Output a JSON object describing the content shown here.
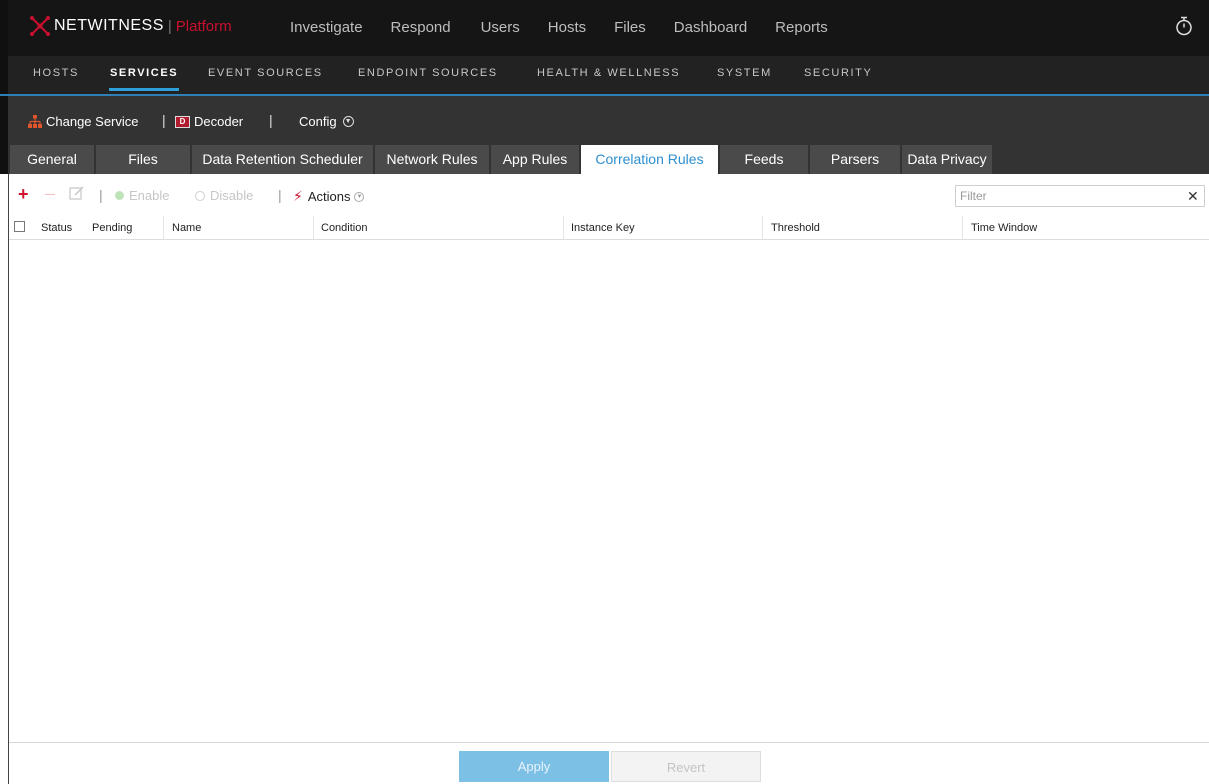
{
  "brand": {
    "name": "NETWITNESS",
    "separator": "|",
    "product": "Platform"
  },
  "topnav": [
    "Investigate",
    "Respond",
    "Users",
    "Hosts",
    "Files",
    "Dashboard",
    "Reports"
  ],
  "subnav": {
    "items": [
      "HOSTS",
      "SERVICES",
      "EVENT SOURCES",
      "ENDPOINT SOURCES",
      "HEALTH & WELLNESS",
      "SYSTEM",
      "SECURITY"
    ],
    "active": "SERVICES"
  },
  "servicebar": {
    "change_service": "Change Service",
    "separator": "|",
    "service_name": "Decoder",
    "service_badge": "D",
    "config": "Config"
  },
  "tabs": {
    "items": [
      "General",
      "Files",
      "Data Retention Scheduler",
      "Network Rules",
      "App Rules",
      "Correlation Rules",
      "Feeds",
      "Parsers",
      "Data Privacy"
    ],
    "active": "Correlation Rules"
  },
  "toolbar": {
    "add": "+",
    "remove": "—",
    "enable": "Enable",
    "disable": "Disable",
    "actions": "Actions",
    "separator": "|"
  },
  "filter": {
    "placeholder": "Filter",
    "value": "",
    "clear": "✕"
  },
  "grid": {
    "columns": [
      "Status",
      "Pending",
      "Name",
      "Condition",
      "Instance Key",
      "Threshold",
      "Time Window"
    ],
    "rows": []
  },
  "footer": {
    "apply": "Apply",
    "revert": "Revert"
  },
  "colors": {
    "accent": "#2e9fd8",
    "brand_red": "#c8102e",
    "apply_button": "#7dc0e6"
  }
}
